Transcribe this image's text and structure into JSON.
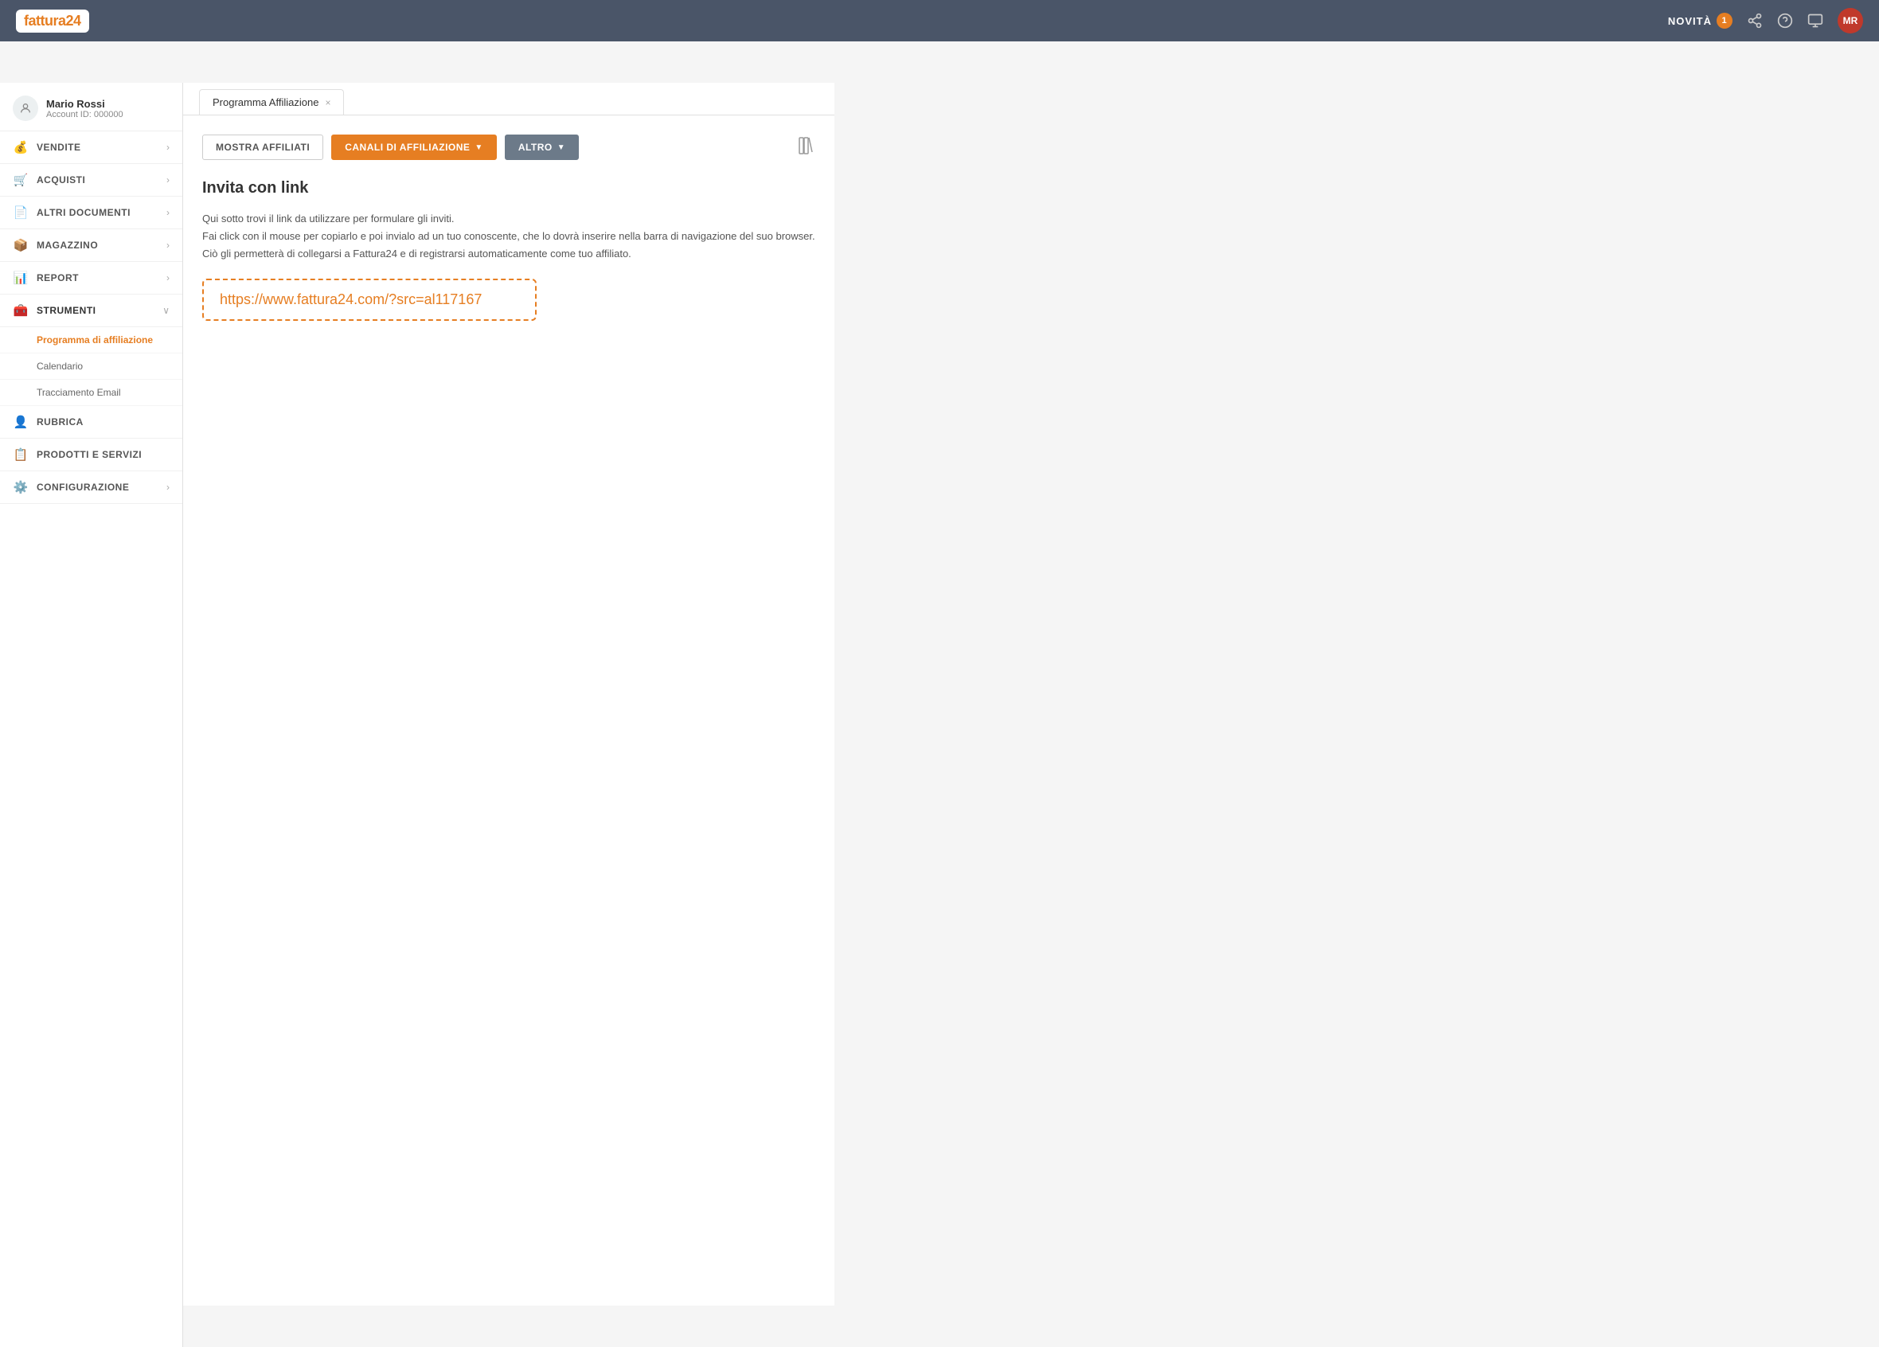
{
  "header": {
    "logo_text": "fattura",
    "logo_suffix": "24",
    "novita_label": "NOVITÀ",
    "novita_count": "1",
    "avatar_initials": "MR"
  },
  "sidebar": {
    "user": {
      "name": "Mario Rossi",
      "account_label": "Account ID: 000000"
    },
    "items": [
      {
        "id": "vendite",
        "label": "VENDITE",
        "icon": "💰",
        "has_children": true,
        "expanded": false
      },
      {
        "id": "acquisti",
        "label": "ACQUISTI",
        "icon": "🛒",
        "has_children": true,
        "expanded": false
      },
      {
        "id": "altri-documenti",
        "label": "ALTRI DOCUMENTI",
        "icon": "📄",
        "has_children": true,
        "expanded": false
      },
      {
        "id": "magazzino",
        "label": "MAGAZZINO",
        "icon": "📦",
        "has_children": true,
        "expanded": false
      },
      {
        "id": "report",
        "label": "REPORT",
        "icon": "📊",
        "has_children": true,
        "expanded": false
      },
      {
        "id": "strumenti",
        "label": "STRUMENTI",
        "icon": "🧰",
        "has_children": true,
        "expanded": true
      },
      {
        "id": "rubrica",
        "label": "RUBRICA",
        "icon": "👤",
        "has_children": false,
        "expanded": false
      },
      {
        "id": "prodotti",
        "label": "PRODOTTI E SERVIZI",
        "icon": "📋",
        "has_children": false,
        "expanded": false
      },
      {
        "id": "configurazione",
        "label": "CONFIGURAZIONE",
        "icon": "⚙️",
        "has_children": true,
        "expanded": false
      }
    ],
    "strumenti_sub": [
      {
        "id": "affiliazione",
        "label": "Programma di affiliazione",
        "active": true
      },
      {
        "id": "calendario",
        "label": "Calendario",
        "active": false
      },
      {
        "id": "tracciamento",
        "label": "Tracciamento Email",
        "active": false
      }
    ]
  },
  "tab": {
    "label": "Programma Affiliazione",
    "close_icon": "×"
  },
  "toolbar": {
    "mostra_affiliati": "MOSTRA AFFILIATI",
    "canali_affiliazione": "CANALI DI AFFILIAZIONE",
    "altro": "ALTRO",
    "books_icon": "📚"
  },
  "content": {
    "title": "Invita con link",
    "desc_line1": "Qui sotto trovi il link da utilizzare per formulare gli inviti.",
    "desc_line2": "Fai click con il mouse per copiarlo e poi invialo ad un tuo conoscente, che lo dovrà inserire nella barra di navigazione del suo browser.",
    "desc_line3": "Ciò gli permetterà di collegarsi a Fattura24 e di registrarsi automaticamente come tuo affiliato.",
    "link_url": "https://www.fattura24.com/?src=al117167"
  }
}
